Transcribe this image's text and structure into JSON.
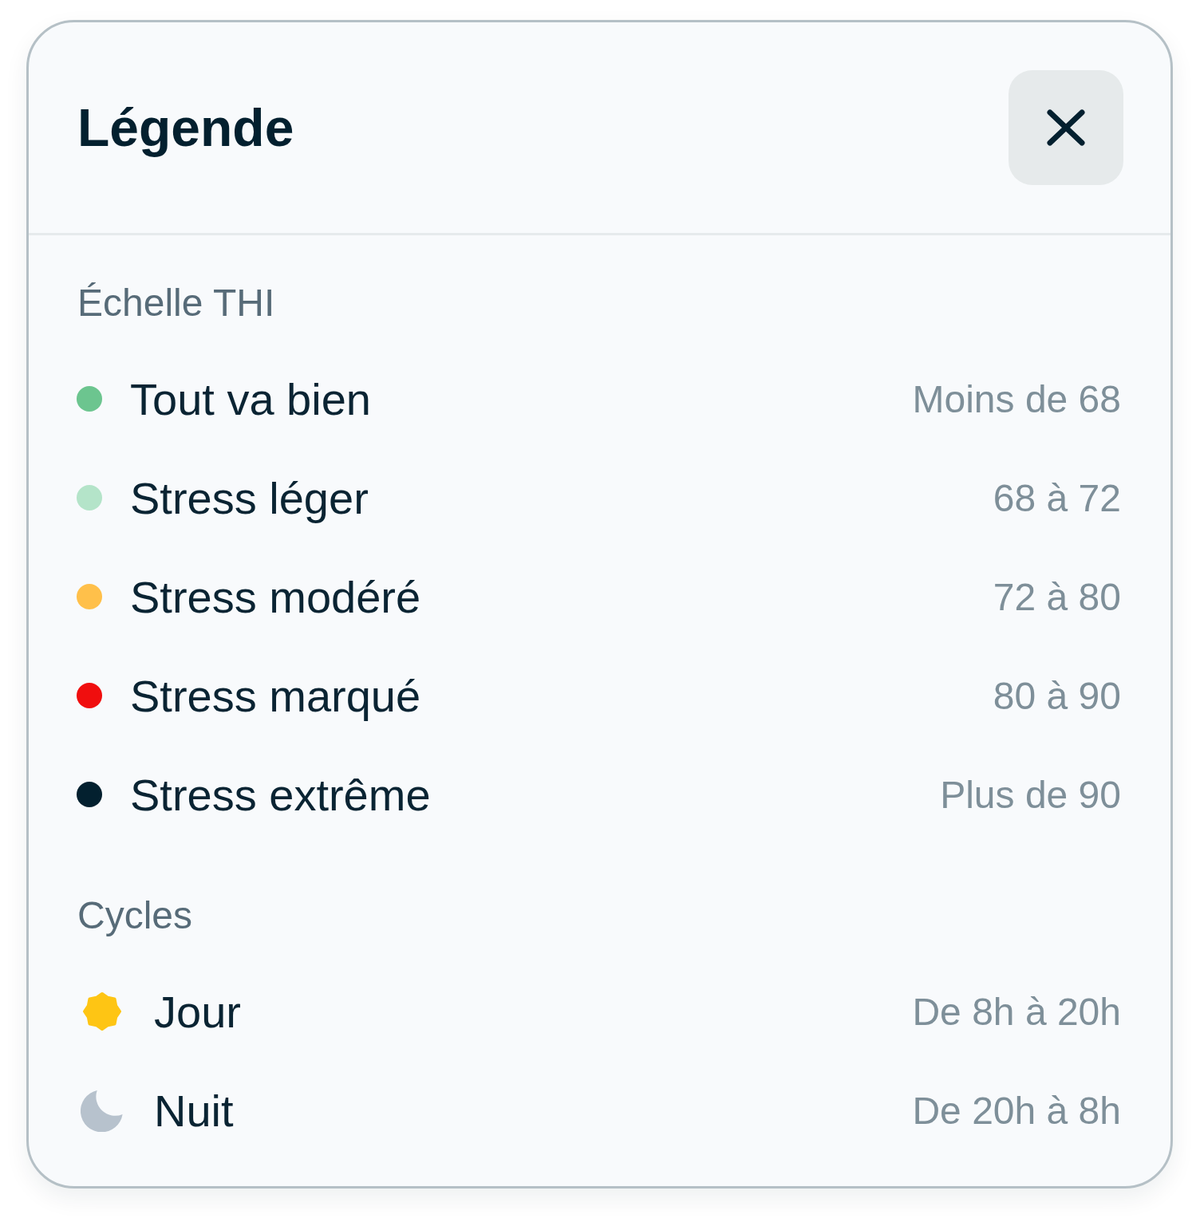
{
  "dialog": {
    "title": "Légende"
  },
  "sections": [
    {
      "title": "Échelle THI",
      "items": [
        {
          "kind": "dot",
          "label": "Tout va bien",
          "value": "Moins de 68",
          "color": "#6cc58f"
        },
        {
          "kind": "dot",
          "label": "Stress léger",
          "value": "68 à 72",
          "color": "#b4e4c9"
        },
        {
          "kind": "dot",
          "label": "Stress modéré",
          "value": "72 à 80",
          "color": "#ffc04a"
        },
        {
          "kind": "dot",
          "label": "Stress marqué",
          "value": "80 à 90",
          "color": "#f00e0e"
        },
        {
          "kind": "dot",
          "label": "Stress extrême",
          "value": "Plus de 90",
          "color": "#03202f"
        }
      ]
    },
    {
      "title": "Cycles",
      "items": [
        {
          "kind": "sun",
          "label": "Jour",
          "value": "De 8h à 20h"
        },
        {
          "kind": "moon",
          "label": "Nuit",
          "value": "De 20h à 8h"
        }
      ]
    }
  ]
}
